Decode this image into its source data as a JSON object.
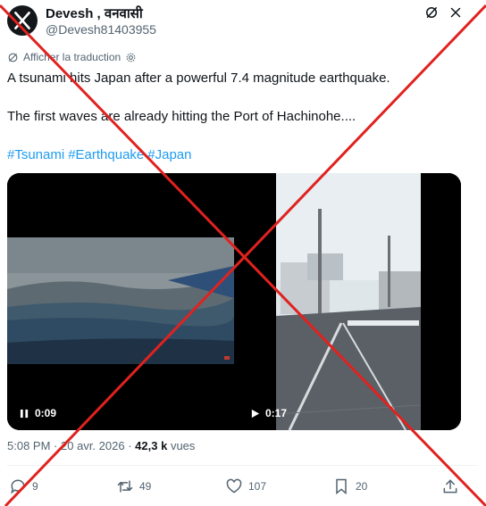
{
  "author": {
    "display_name": "Devesh , वनवासी",
    "handle": "@Devesh81403955",
    "avatar_icon": "x-logo-icon"
  },
  "header_icons": [
    "grok-icon",
    "more-icon"
  ],
  "translate": {
    "label": "Afficher la traduction",
    "icon": "translate-icon",
    "settings_icon": "gear-icon"
  },
  "tweet": {
    "line1": "A tsunami hits Japan after a powerful 7.4 magnitude earthquake.",
    "line2": "The first waves are already hitting the Port of Hachinohe....",
    "hashtags": [
      "#Tsunami",
      "#Earthquake",
      "#Japan"
    ]
  },
  "media": {
    "video1": {
      "state": "paused",
      "time": "0:09"
    },
    "video2": {
      "state": "play",
      "time": "0:17"
    }
  },
  "meta": {
    "time": "5:08 PM",
    "separator": "·",
    "date": "20 avr. 2026",
    "views": "42,3 k",
    "views_label": "vues"
  },
  "actions": {
    "replies": "9",
    "reposts": "49",
    "likes": "107",
    "bookmarks": "20"
  },
  "colors": {
    "accent": "#1d9bf0",
    "overlay_cross": "#e0221f",
    "text": "#0f1419",
    "secondary": "#536471"
  }
}
